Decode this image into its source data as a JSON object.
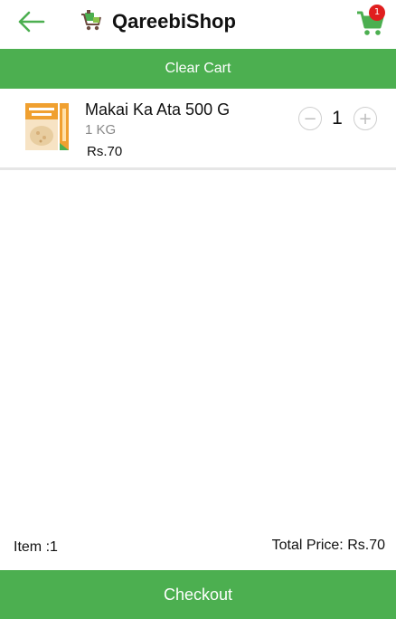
{
  "header": {
    "title": "QareebiShop",
    "back_icon": "arrow-left-icon",
    "logo_icon": "shop-cart-logo-icon",
    "cart_icon": "shopping-cart-icon",
    "cart_badge": "1",
    "accent_color": "#4caf50",
    "badge_color": "#e01e1e"
  },
  "actions": {
    "clear_cart_label": "Clear Cart",
    "checkout_label": "Checkout"
  },
  "cart": {
    "items": [
      {
        "name": "Makai Ka Ata 500 G",
        "weight": "1 KG",
        "price": "Rs.70",
        "quantity": "1",
        "image_icon": "flour-bag-image"
      }
    ]
  },
  "summary": {
    "item_count": "Item :1",
    "total_price": "Total Price: Rs.70"
  }
}
